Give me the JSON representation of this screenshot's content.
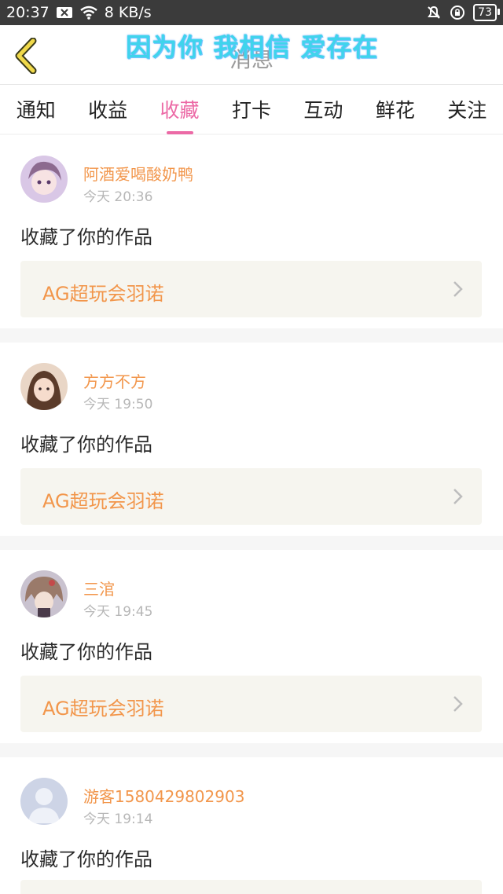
{
  "statusbar": {
    "time": "20:37",
    "speed": "8 KB/s",
    "battery": "73"
  },
  "header": {
    "title": "消息",
    "overlay_text": "因为你 我相信 爱存在"
  },
  "tabs": [
    {
      "label": "通知"
    },
    {
      "label": "收益"
    },
    {
      "label": "收藏",
      "active": true
    },
    {
      "label": "打卡"
    },
    {
      "label": "互动"
    },
    {
      "label": "鲜花"
    },
    {
      "label": "关注"
    }
  ],
  "messages": [
    {
      "username": "阿酒爱喝酸奶鸭",
      "time": "今天 20:36",
      "action": "收藏了你的作品",
      "work": "AG超玩会羽诺"
    },
    {
      "username": "方方不方",
      "time": "今天 19:50",
      "action": "收藏了你的作品",
      "work": "AG超玩会羽诺"
    },
    {
      "username": "三涫",
      "time": "今天 19:45",
      "action": "收藏了你的作品",
      "work": "AG超玩会羽诺"
    },
    {
      "username": "游客1580429802903",
      "time": "今天 19:14",
      "action": "收藏了你的作品",
      "work": ""
    }
  ],
  "colors": {
    "accent_pink": "#ec6aa6",
    "username_orange": "#f2964b",
    "statusbar_bg": "#3b3b3b"
  }
}
